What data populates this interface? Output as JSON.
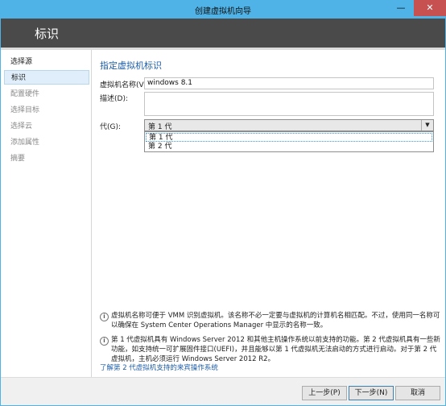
{
  "window": {
    "title": "创建虚拟机向导",
    "minimize_label": "—",
    "close_label": "✕",
    "header_title": "标识"
  },
  "sidebar": {
    "items": [
      {
        "label": "选择源"
      },
      {
        "label": "标识"
      },
      {
        "label": "配置硬件"
      },
      {
        "label": "选择目标"
      },
      {
        "label": "选择云"
      },
      {
        "label": "添加属性"
      },
      {
        "label": "摘要"
      }
    ]
  },
  "main": {
    "section_title": "指定虚拟机标识",
    "name_label": "虚拟机名称(V):",
    "name_value": "windows 8.1",
    "description_label": "描述(D):",
    "description_value": "",
    "generation_label": "代(G):",
    "generation_selected": "第 1 代",
    "generation_options": [
      "第 1 代",
      "第 2 代"
    ],
    "info1": "虚拟机名称可便于 VMM 识别虚拟机。该名称不必一定要与虚拟机的计算机名相匹配。不过，使用同一名称可以确保在 System Center Operations Manager 中显示的名称一致。",
    "info2": "第 1 代虚拟机具有 Windows Server 2012 和其他主机操作系统以前支持的功能。第 2 代虚拟机具有一些新功能，如支持统一可扩展固件接口(UEFI)，并且能够以第 1 代虚拟机无法启动的方式进行启动。对于第 2 代虚拟机，主机必须运行 Windows Server 2012 R2。",
    "link": "了解第 2 代虚拟机支持的来宾操作系统"
  },
  "footer": {
    "prev_label": "上一步(P)",
    "next_label": "下一步(N)",
    "cancel_label": "取消"
  }
}
